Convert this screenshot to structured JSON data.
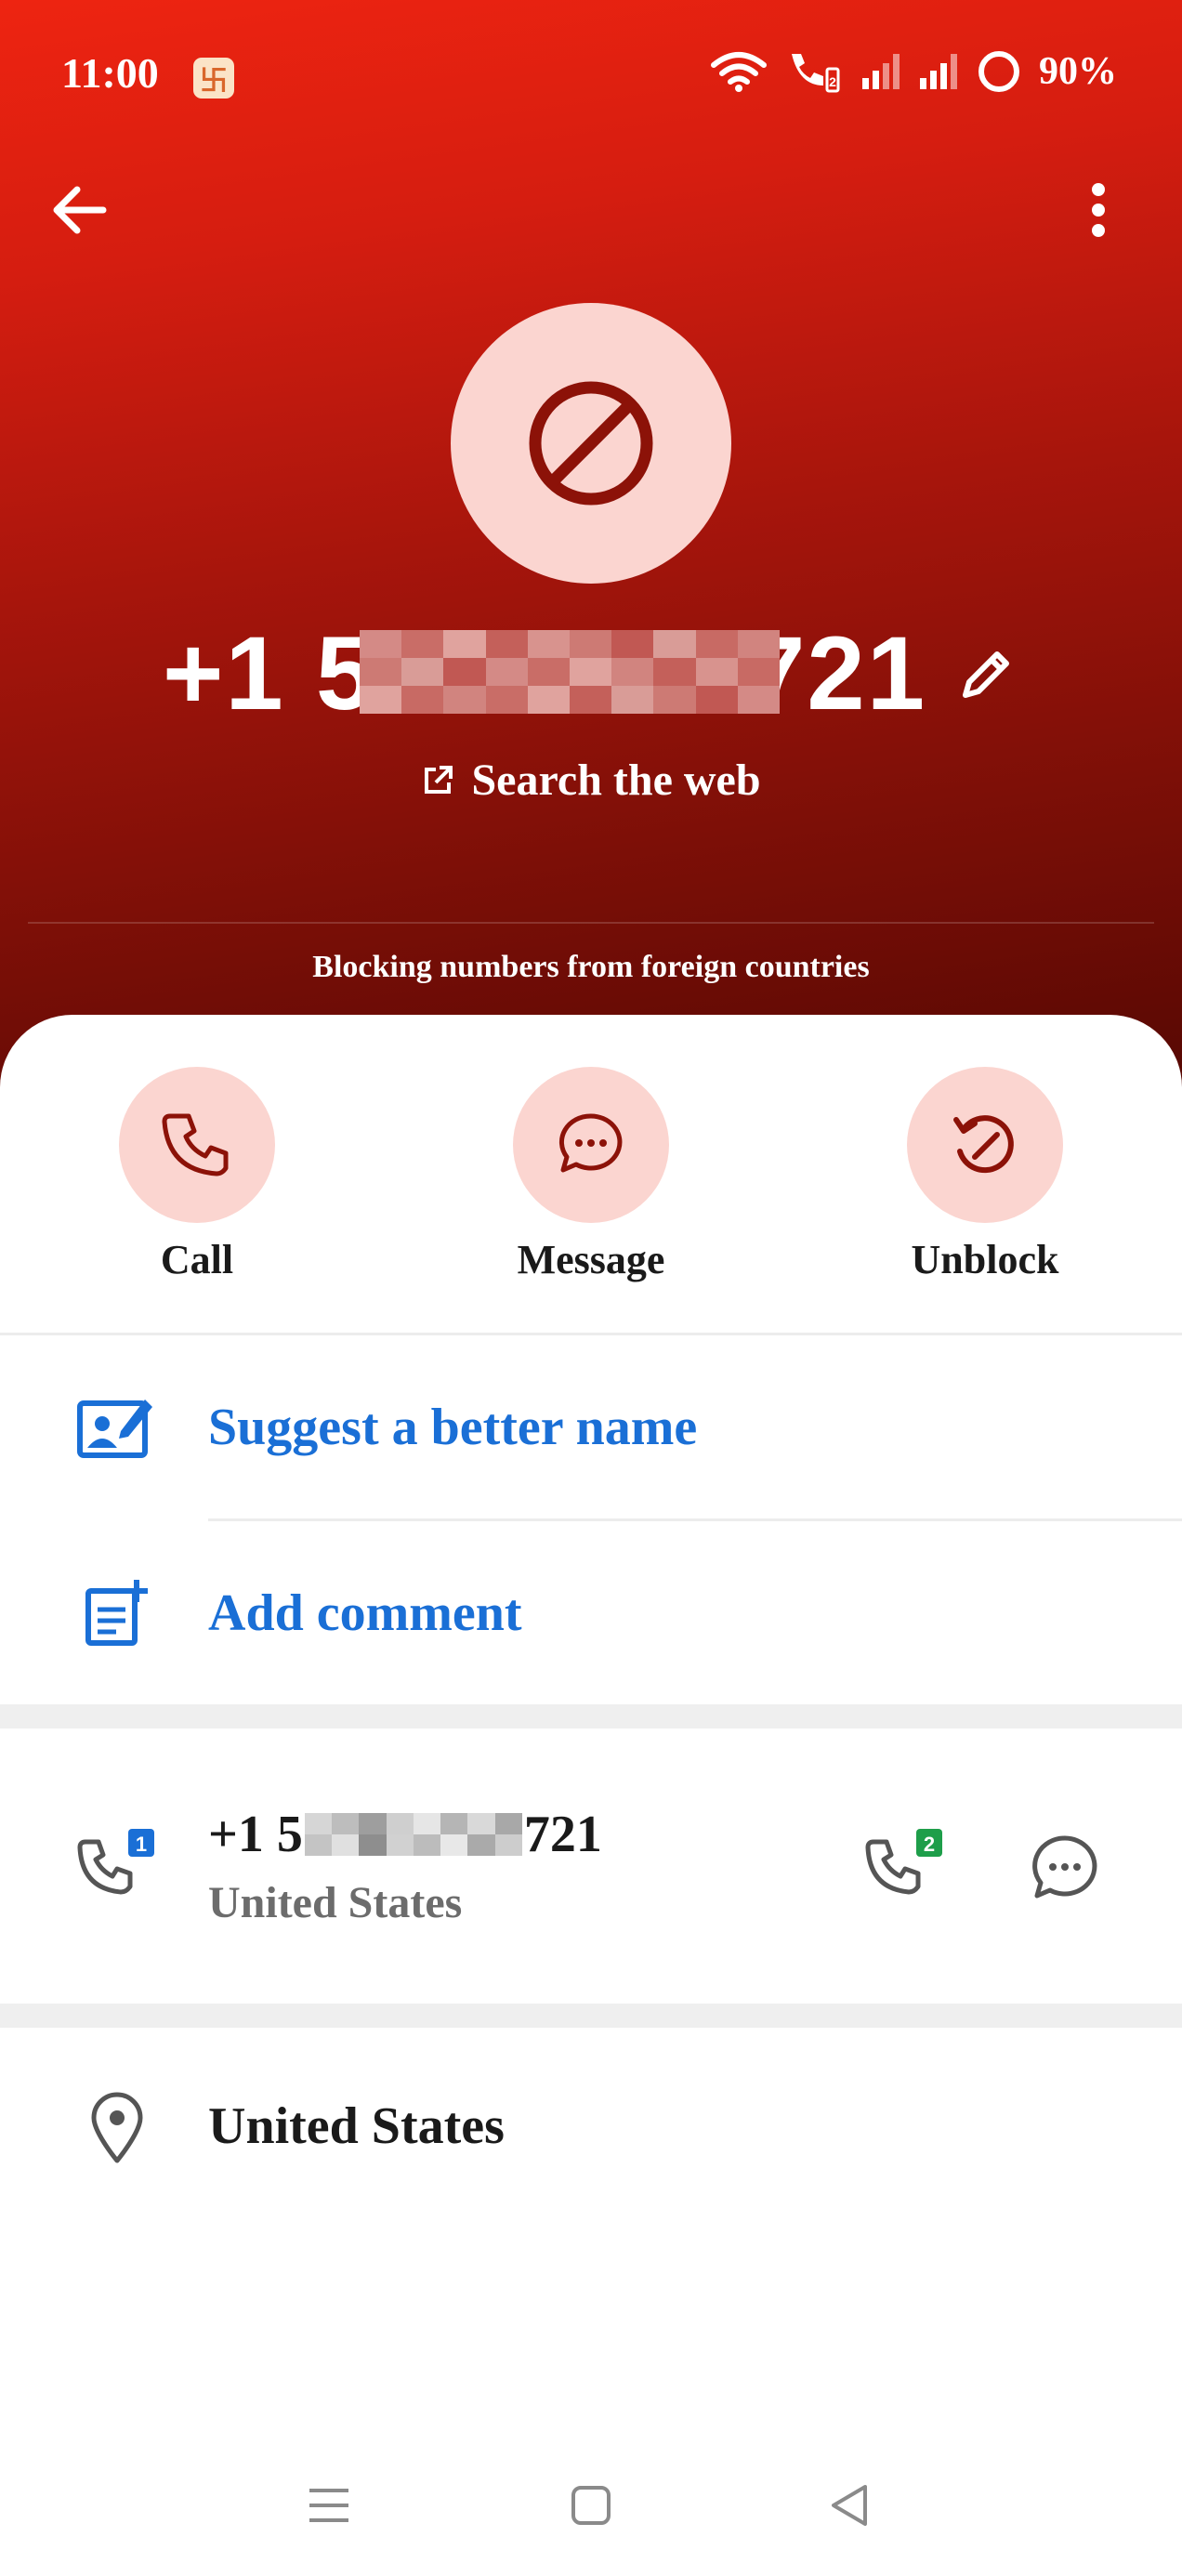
{
  "status_bar": {
    "time": "11:00",
    "battery": "90%"
  },
  "contact": {
    "number_prefix": "+1 5",
    "number_suffix": "721",
    "search_web": "Search the web",
    "block_reason": "Blocking numbers from foreign countries"
  },
  "actions": [
    {
      "label": "Call"
    },
    {
      "label": "Message"
    },
    {
      "label": "Unblock"
    }
  ],
  "links": {
    "suggest_name": "Suggest a better name",
    "add_comment": "Add comment"
  },
  "phone_entry": {
    "number_prefix": "+1 5",
    "number_suffix": "721",
    "country": "United States",
    "sim1_badge": "1",
    "sim2_badge": "2"
  },
  "location": {
    "country": "United States"
  },
  "colors": {
    "header_top": "#ee2411",
    "header_bottom": "#560803",
    "accent_soft": "#fbd5d0",
    "icon_dark_red": "#8c1208",
    "link_blue": "#1a6fd6",
    "sim1_blue": "#1a6fd6",
    "sim2_green": "#1e9e4a"
  },
  "icons": {
    "back": "arrow-left-icon",
    "more": "more-vert-icon",
    "avatar": "block-icon",
    "edit": "pencil-icon",
    "search": "open-external-icon",
    "call": "phone-icon",
    "message": "chat-bubble-icon",
    "unblock": "unblock-icon",
    "suggest": "contact-edit-icon",
    "comment": "note-add-icon",
    "location": "location-pin-icon"
  }
}
